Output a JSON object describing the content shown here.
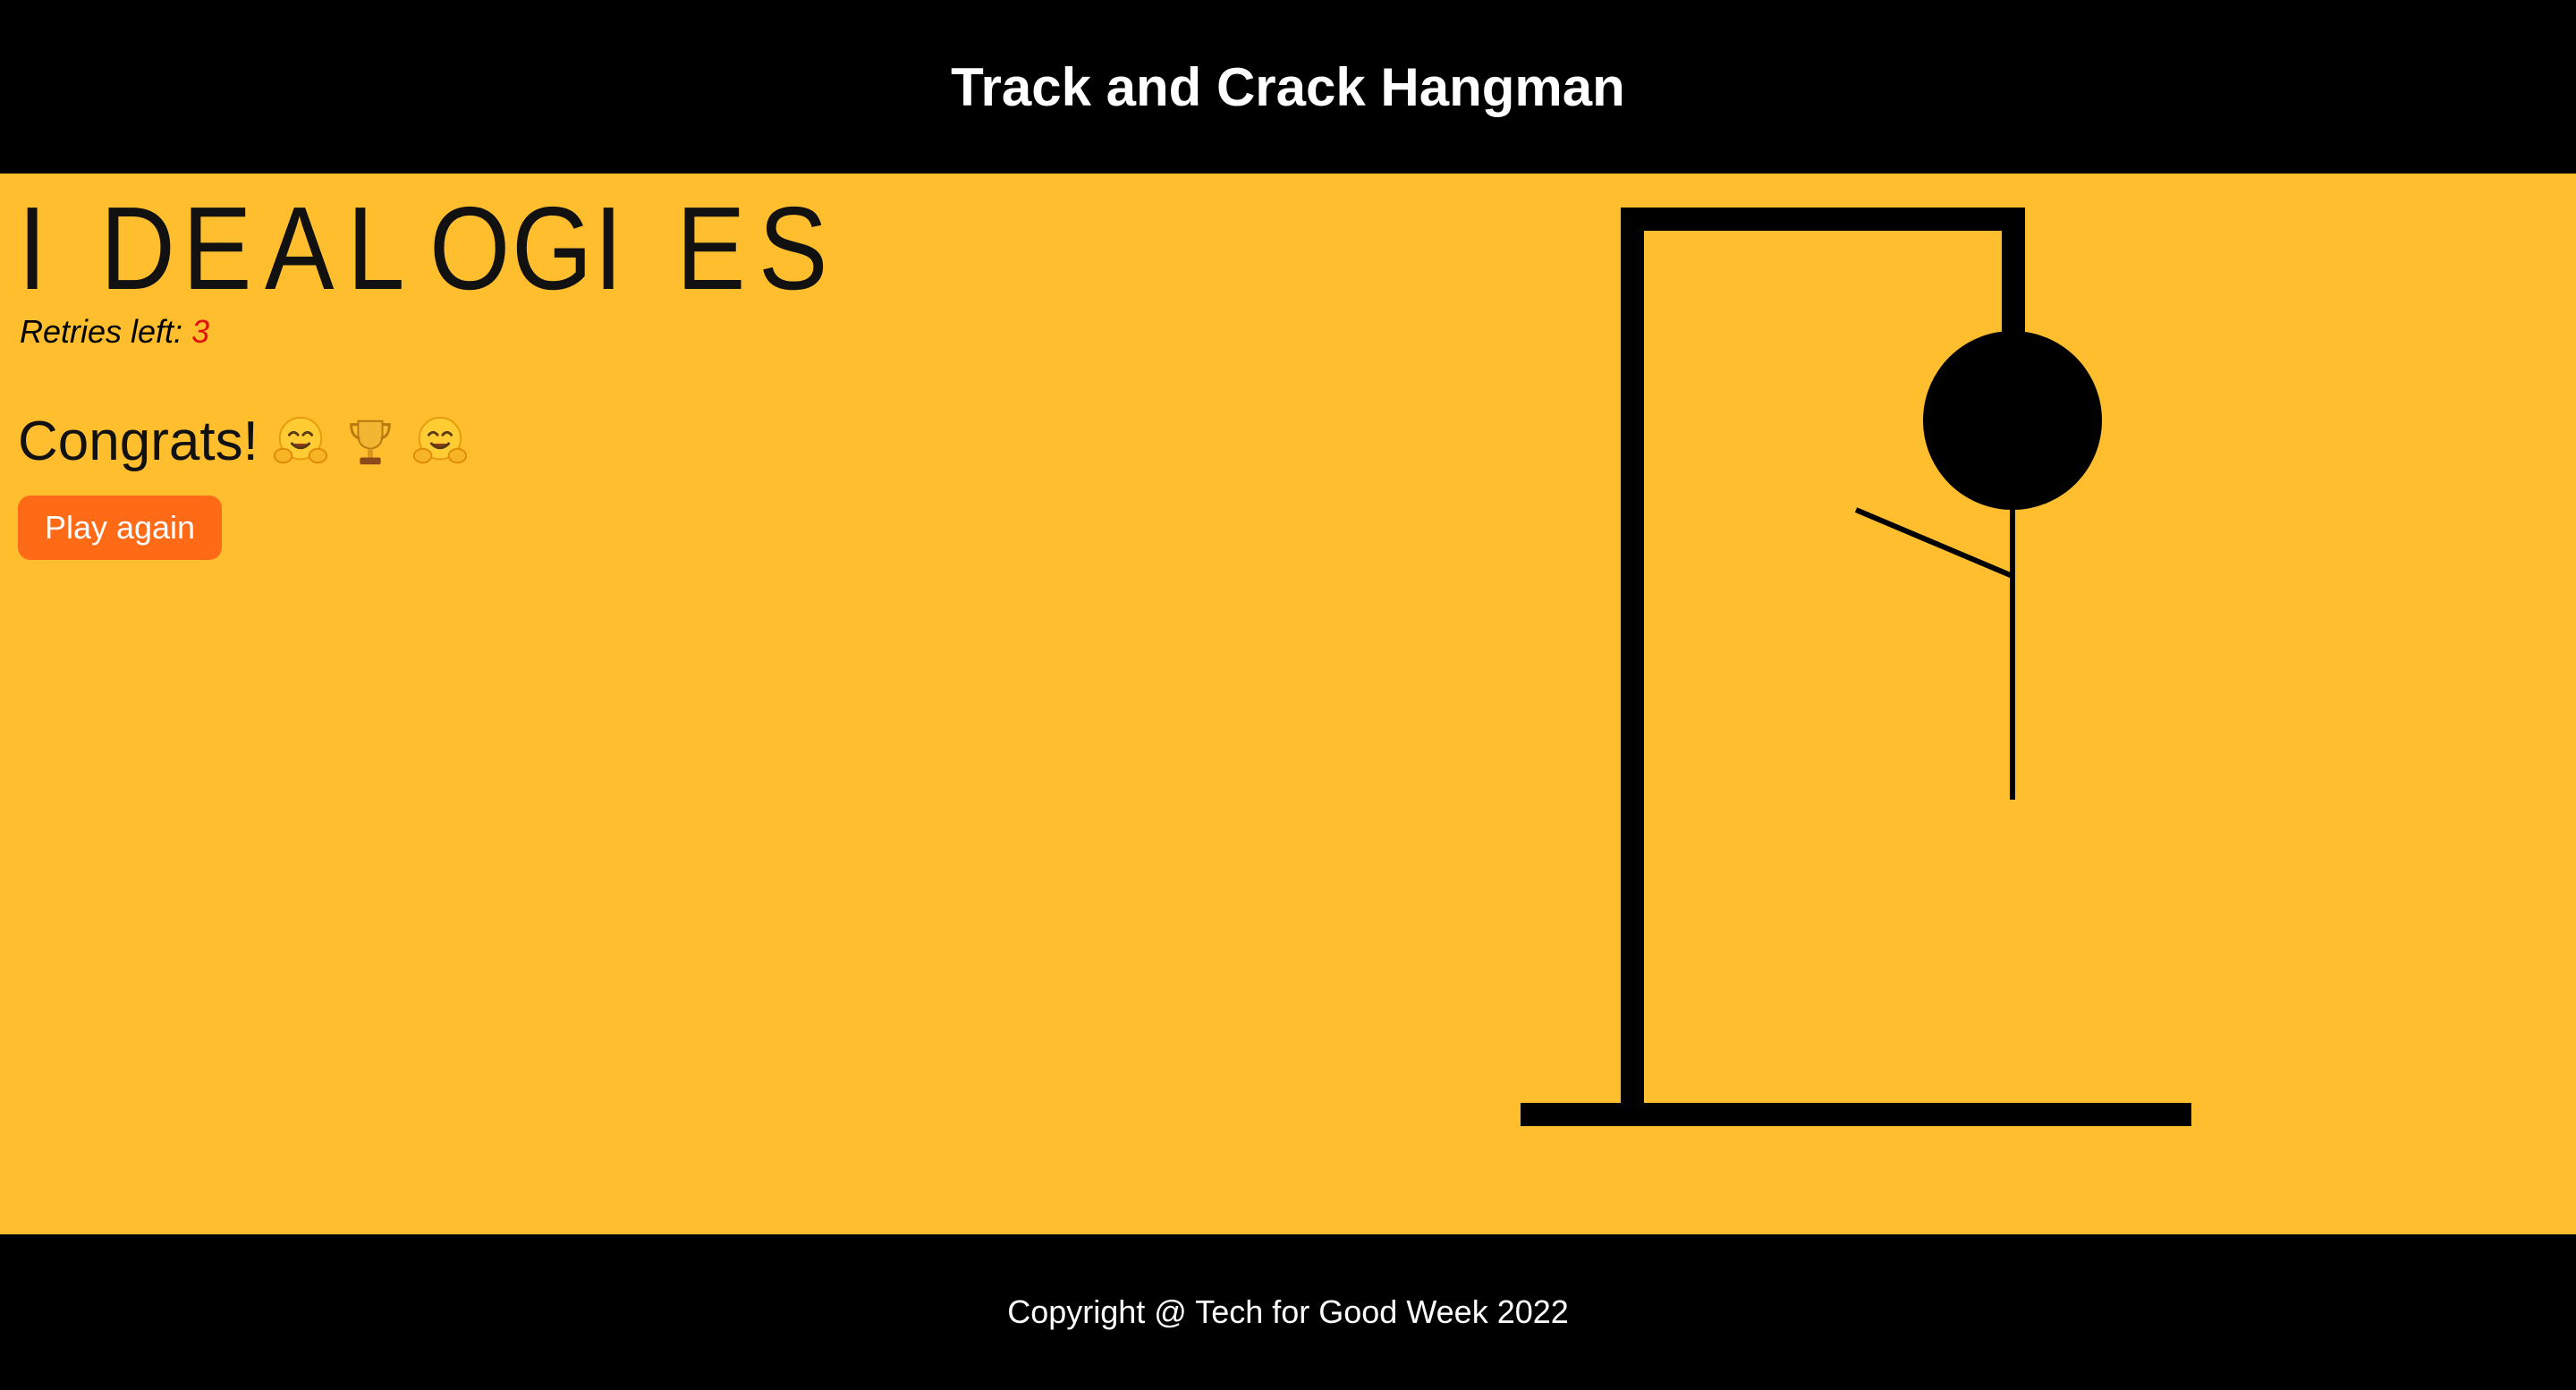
{
  "header": {
    "title": "Track and Crack Hangman"
  },
  "game": {
    "word_letters": [
      "I",
      "D",
      "E",
      "A",
      "L",
      "O",
      "G",
      "I",
      "E",
      "S"
    ],
    "retries_label": "Retries left:",
    "retries_count": "3",
    "congrats_text": "Congrats!",
    "congrats_emojis": [
      "smiling-face-hugging-icon",
      "trophy-icon",
      "smiling-face-hugging-icon"
    ],
    "play_again_label": "Play again"
  },
  "footer": {
    "copyright": "Copyright @ Tech for Good Week 2022"
  },
  "colors": {
    "background": "#FFBE2E",
    "bars": "#000000",
    "button": "#FF6A17",
    "retries_count": "#E0110B"
  }
}
